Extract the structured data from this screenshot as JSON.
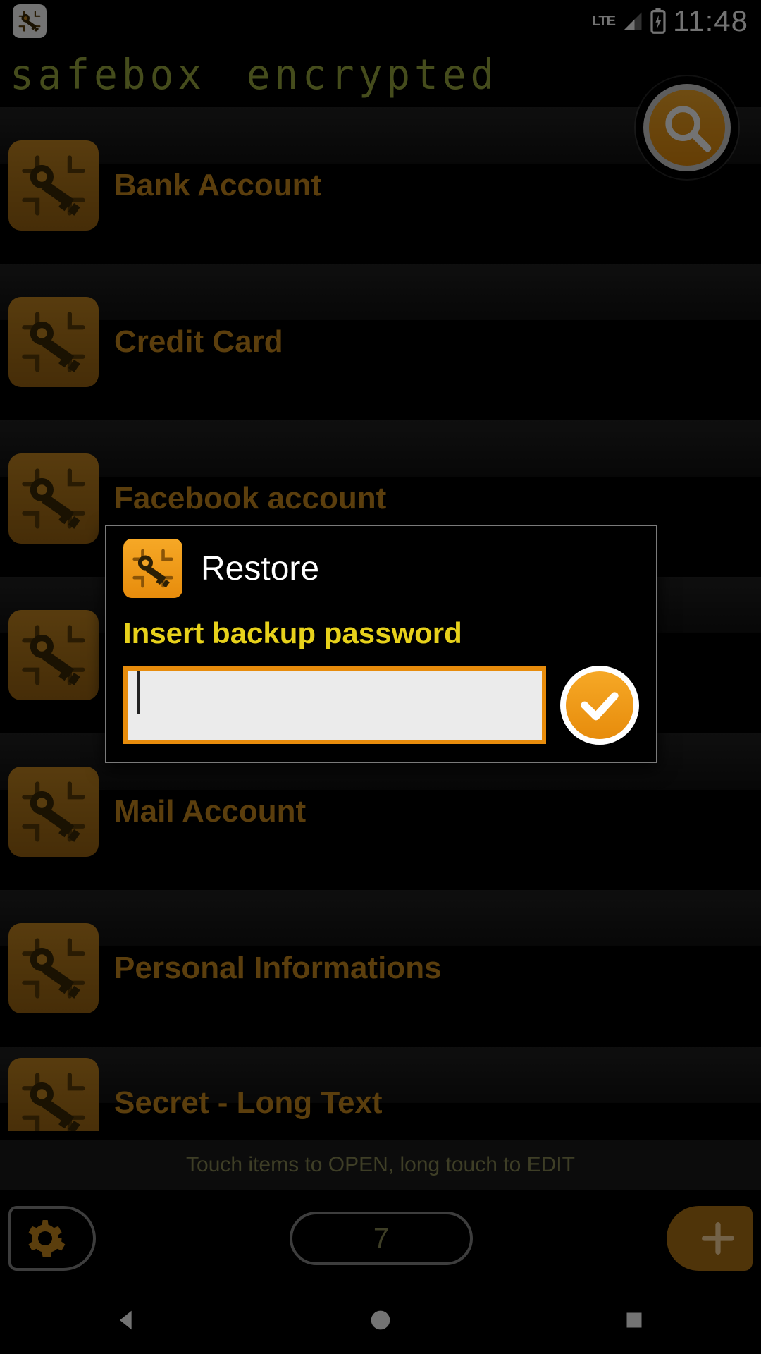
{
  "status": {
    "network_label": "LTE",
    "time": "11:48"
  },
  "header": {
    "title": "safebox encrypted"
  },
  "list": {
    "items": [
      {
        "label": "Bank Account"
      },
      {
        "label": "Credit Card"
      },
      {
        "label": "Facebook account"
      },
      {
        "label": ""
      },
      {
        "label": "Mail Account"
      },
      {
        "label": "Personal Informations"
      },
      {
        "label": "Secret - Long Text"
      }
    ]
  },
  "hint": "Touch items to OPEN, long touch to EDIT",
  "toolbar": {
    "count": "7"
  },
  "dialog": {
    "title": "Restore",
    "label": "Insert backup password",
    "value": ""
  }
}
